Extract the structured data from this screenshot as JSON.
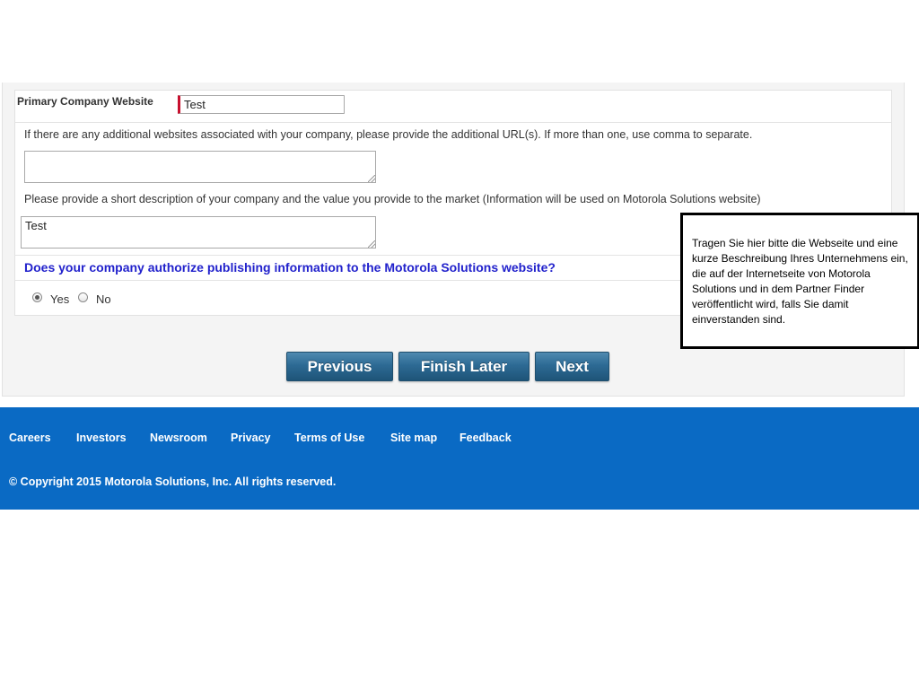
{
  "form": {
    "website_label": "Primary Company Website",
    "website_value": "Test",
    "additional_urls_label": "If there are any additional websites associated with your company, please provide the additional URL(s). If more than one, use comma to separate.",
    "additional_urls_value": "",
    "description_label": "Please provide a short description of your company and the value you provide to the market (Information will be used on Motorola Solutions website)",
    "description_value": "Test",
    "authorize_question": "Does your company authorize publishing information to the Motorola Solutions website?",
    "authorize_options": [
      {
        "label": "Yes",
        "checked": true
      },
      {
        "label": "No",
        "checked": false
      }
    ]
  },
  "buttons": {
    "previous": "Previous",
    "finish_later": "Finish Later",
    "next": "Next"
  },
  "tooltip": {
    "text": "Tragen Sie hier  bitte  die  Webseite und eine kurze Beschreibung Ihres Unternehmens ein,  die auf der Internetseite von Motorola Solutions und in dem Partner Finder veröffentlicht wird, falls  Sie damit einverstanden sind."
  },
  "footer": {
    "links": [
      "Careers",
      "Investors",
      "Newsroom",
      "Privacy",
      "Terms of Use",
      "Site map",
      "Feedback"
    ],
    "copyright": "© Copyright 2015 Motorola Solutions, Inc. All rights reserved."
  },
  "colors": {
    "footer_bg": "#0a6ac4",
    "question_text": "#2222cc",
    "required_marker": "#c8102e",
    "button_bg": "#2d6a94"
  }
}
